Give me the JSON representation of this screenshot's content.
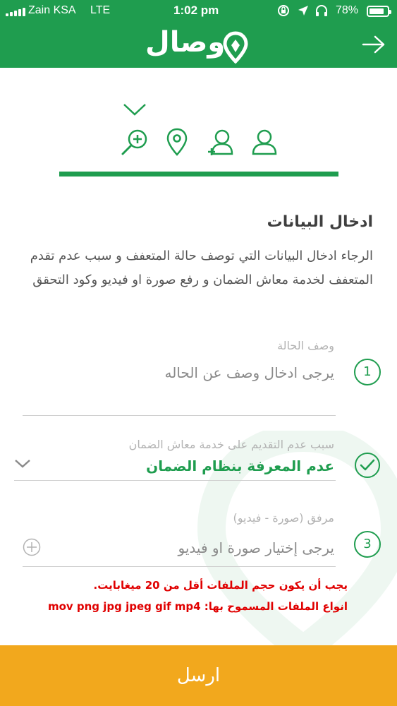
{
  "status_bar": {
    "carrier": "Zain KSA",
    "network": "LTE",
    "time": "1:02 pm",
    "battery": "78%",
    "icons": [
      "signal-bars-icon",
      "orientation-lock-icon",
      "location-arrow-icon",
      "headphones-icon",
      "battery-icon"
    ]
  },
  "header": {
    "logo_text": "وصال",
    "back_icon": "arrow-right-icon",
    "color": "#1f9d4f"
  },
  "stepper": {
    "icons": [
      "search-plus-icon",
      "location-pin-icon",
      "add-user-icon",
      "user-icon"
    ],
    "current_indicator": "chevron-down-icon"
  },
  "form": {
    "title": "ادخال البيانات",
    "intro": "الرجاء ادخال البيانات التي توصف حالة المتعفف و سبب عدم تقدم المتعفف لخدمة معاش الضمان و رفع صورة او فيديو وكود التحقق",
    "field1": {
      "number": "1",
      "label": "وصف الحالة",
      "placeholder": "يرجى ادخال وصف عن الحاله"
    },
    "field2": {
      "label": "سبب عدم التقديم على خدمة معاش الضمان",
      "value": "عدم المعرفة بنظام الضمان"
    },
    "field3": {
      "number": "3",
      "label": "مرفق (صورة - فيديو)",
      "placeholder": "يرجى إختيار صورة او فيديو"
    },
    "warning_size": "يجب أن يكون حجم الملفات أقل من 20 ميغابايت.",
    "warning_types": "انواع الملفات المسموح بها: mov png jpg jpeg gif mp4"
  },
  "submit_label": "ارسل",
  "colors": {
    "primary": "#1f9d4f",
    "accent": "#f2a81d",
    "warning": "#e00000"
  }
}
